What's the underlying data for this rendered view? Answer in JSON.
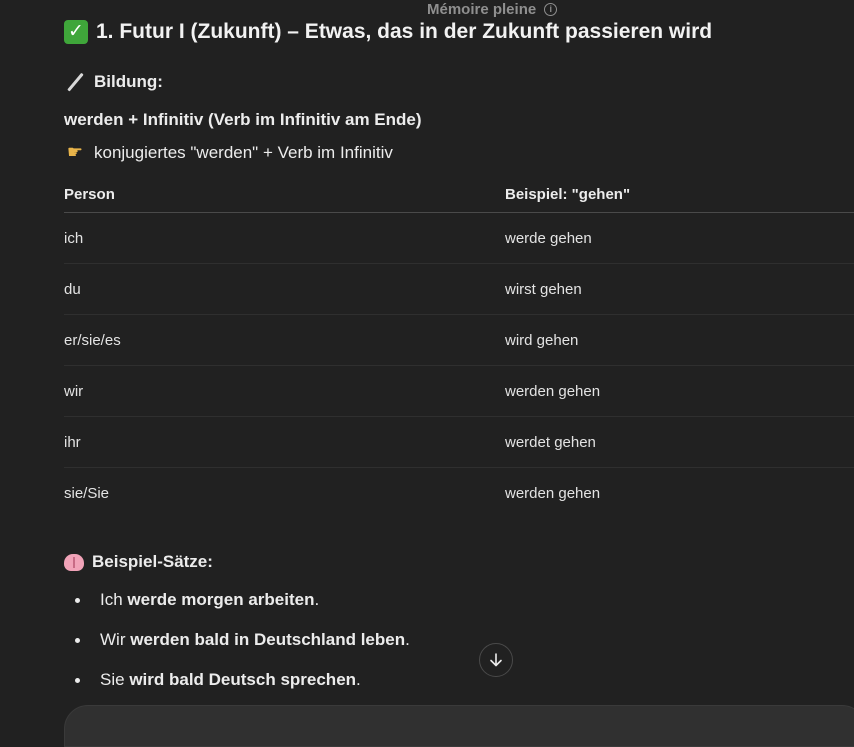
{
  "header": {
    "memory_status": "Mémoire pleine",
    "info_icon": "i"
  },
  "section": {
    "title": "1. Futur I (Zukunft) – Etwas, das in der Zukunft passieren wird",
    "title_icon": "check-mark-icon",
    "bildung_label": "Bildung:",
    "bildung_icon": "magic-wand-icon",
    "formula": "werden + Infinitiv (Verb im Infinitiv am Ende)",
    "hint_icon": "pointing-hand-icon",
    "hint": "konjugiertes \"werden\" + Verb im Infinitiv"
  },
  "table": {
    "headers": [
      "Person",
      "Beispiel: \"gehen\""
    ],
    "rows": [
      [
        "ich",
        "werde gehen"
      ],
      [
        "du",
        "wirst gehen"
      ],
      [
        "er/sie/es",
        "wird gehen"
      ],
      [
        "wir",
        "werden gehen"
      ],
      [
        "ihr",
        "werdet gehen"
      ],
      [
        "sie/Sie",
        "werden gehen"
      ]
    ]
  },
  "examples": {
    "heading": "Beispiel-Sätze:",
    "heading_icon": "brain-icon",
    "items": [
      {
        "pre": "Ich ",
        "bold": "werde morgen arbeiten",
        "post": "."
      },
      {
        "pre": "Wir ",
        "bold": "werden bald in Deutschland leben",
        "post": "."
      },
      {
        "pre": "Sie ",
        "bold": "wird bald Deutsch sprechen",
        "post": "."
      }
    ]
  },
  "controls": {
    "scroll_down_icon": "arrow-down-icon"
  },
  "colors": {
    "background": "#212121",
    "text": "#ececec",
    "check": "#3fa63a"
  }
}
